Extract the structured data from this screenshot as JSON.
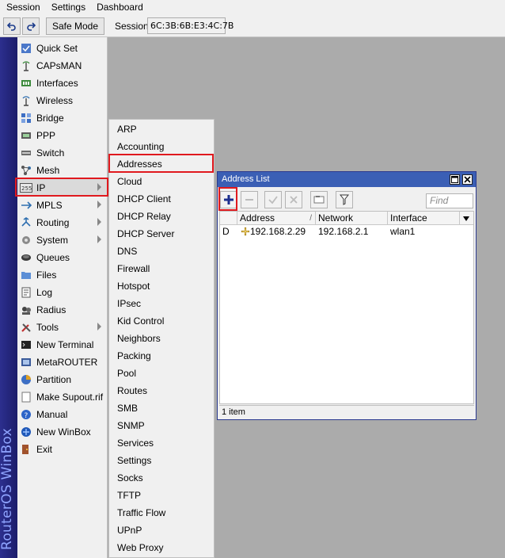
{
  "menubar": {
    "items": [
      "Session",
      "Settings",
      "Dashboard"
    ]
  },
  "toolbar": {
    "safe_mode_label": "Safe Mode",
    "session_label": "Session:",
    "session_value": "6C:3B:6B:E3:4C:7B"
  },
  "brand": {
    "text": "RouterOS WinBox"
  },
  "main_menu": {
    "items": [
      {
        "label": "Quick Set",
        "icon": "quick-set-icon"
      },
      {
        "label": "CAPsMAN",
        "icon": "capsman-icon"
      },
      {
        "label": "Interfaces",
        "icon": "interfaces-icon"
      },
      {
        "label": "Wireless",
        "icon": "wireless-icon"
      },
      {
        "label": "Bridge",
        "icon": "bridge-icon"
      },
      {
        "label": "PPP",
        "icon": "ppp-icon"
      },
      {
        "label": "Switch",
        "icon": "switch-icon"
      },
      {
        "label": "Mesh",
        "icon": "mesh-icon"
      },
      {
        "label": "IP",
        "icon": "ip-icon",
        "submenu": true
      },
      {
        "label": "MPLS",
        "icon": "mpls-icon",
        "submenu": true
      },
      {
        "label": "Routing",
        "icon": "routing-icon",
        "submenu": true
      },
      {
        "label": "System",
        "icon": "system-icon",
        "submenu": true
      },
      {
        "label": "Queues",
        "icon": "queues-icon"
      },
      {
        "label": "Files",
        "icon": "files-icon"
      },
      {
        "label": "Log",
        "icon": "log-icon"
      },
      {
        "label": "Radius",
        "icon": "radius-icon"
      },
      {
        "label": "Tools",
        "icon": "tools-icon",
        "submenu": true
      },
      {
        "label": "New Terminal",
        "icon": "terminal-icon"
      },
      {
        "label": "MetaROUTER",
        "icon": "metarouter-icon"
      },
      {
        "label": "Partition",
        "icon": "partition-icon"
      },
      {
        "label": "Make Supout.rif",
        "icon": "supout-icon"
      },
      {
        "label": "Manual",
        "icon": "manual-icon"
      },
      {
        "label": "New WinBox",
        "icon": "winbox-icon"
      },
      {
        "label": "Exit",
        "icon": "exit-icon"
      }
    ]
  },
  "ip_submenu": {
    "items": [
      "ARP",
      "Accounting",
      "Addresses",
      "Cloud",
      "DHCP Client",
      "DHCP Relay",
      "DHCP Server",
      "DNS",
      "Firewall",
      "Hotspot",
      "IPsec",
      "Kid Control",
      "Neighbors",
      "Packing",
      "Pool",
      "Routes",
      "SMB",
      "SNMP",
      "Services",
      "Settings",
      "Socks",
      "TFTP",
      "Traffic Flow",
      "UPnP",
      "Web Proxy"
    ]
  },
  "address_list": {
    "title": "Address List",
    "find_placeholder": "Find",
    "columns": [
      "Address",
      "Network",
      "Interface"
    ],
    "sort_marker": "/",
    "rows": [
      {
        "flag": "D",
        "address": "192.168.2.29",
        "network": "192.168.2.1",
        "interface": "wlan1"
      }
    ],
    "status": "1 item"
  },
  "colors": {
    "highlight": "#e0191e",
    "title_bar": "#3b5fb5",
    "brand_bar": "#2c2f8e",
    "workspace": "#ababab"
  }
}
